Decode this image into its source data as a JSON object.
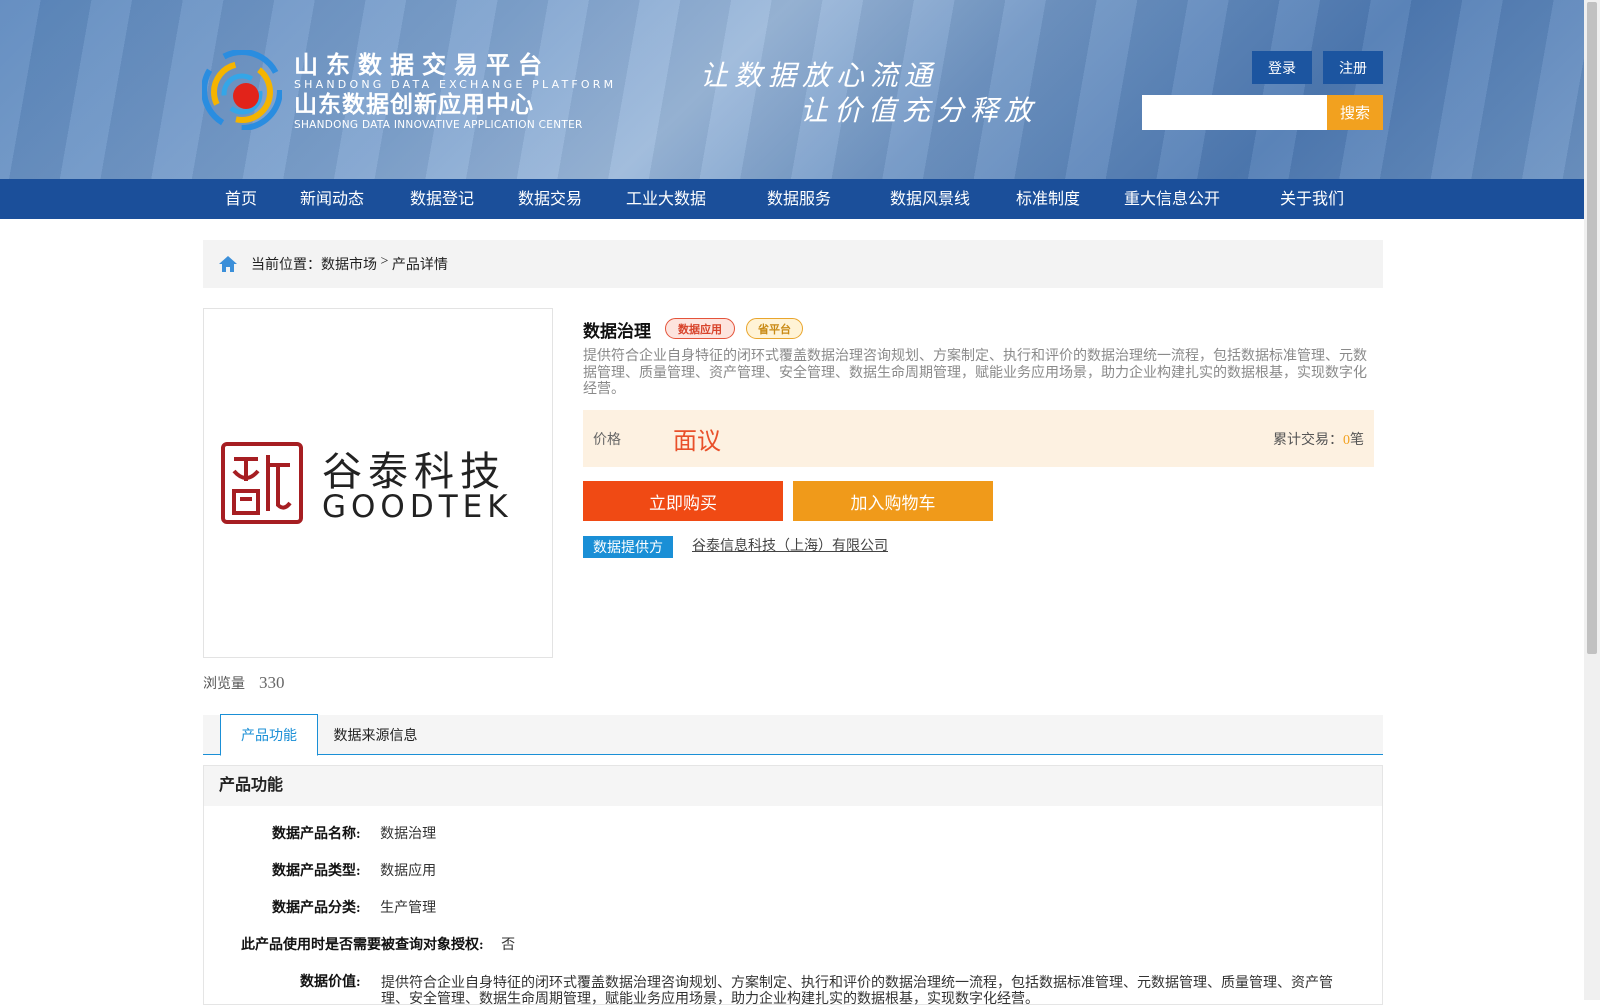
{
  "header": {
    "logo_cn_1": "山东数据交易平台",
    "logo_en_1": "SHANDONG DATA EXCHANGE PLATFORM",
    "logo_cn_2": "山东数据创新应用中心",
    "logo_en_2": "SHANDONG DATA INNOVATIVE APPLICATION CENTER",
    "slogan_1": "让数据放心流通",
    "slogan_2": "让价值充分释放",
    "login_label": "登录",
    "register_label": "注册",
    "search_placeholder": "",
    "search_label": "搜索"
  },
  "nav": {
    "items": [
      "首页",
      "新闻动态",
      "数据登记",
      "数据交易",
      "工业大数据",
      "数据服务",
      "数据风景线",
      "标准制度",
      "重大信息公开",
      "关于我们"
    ]
  },
  "breadcrumb": {
    "prefix": "当前位置：",
    "market": "数据市场",
    "separator": " > ",
    "current": "产品详情"
  },
  "product": {
    "logo_cn": "谷泰科技",
    "logo_en": "GOODTEK",
    "views_label": "浏览量",
    "views_count": "330",
    "title": "数据治理",
    "tag_app": "数据应用",
    "tag_prov": "省平台",
    "description": "提供符合企业自身特征的闭环式覆盖数据治理咨询规划、方案制定、执行和评价的数据治理统一流程，包括数据标准管理、元数据管理、质量管理、资产管理、安全管理、数据生命周期管理，赋能业务应用场景，助力企业构建扎实的数据根基，实现数字化经营。",
    "price_label": "价格",
    "price_value": "面议",
    "trade_label": "累计交易：",
    "trade_count": "0",
    "trade_unit": "笔",
    "buy_label": "立即购买",
    "cart_label": "加入购物车",
    "provider_label": "数据提供方",
    "provider_name": "谷泰信息科技（上海）有限公司"
  },
  "tabs": {
    "features": "产品功能",
    "source": "数据来源信息"
  },
  "features": {
    "heading": "产品功能",
    "name_label": "数据产品名称:",
    "name_value": "数据治理",
    "type_label": "数据产品类型:",
    "type_value": "数据应用",
    "category_label": "数据产品分类:",
    "category_value": "生产管理",
    "auth_label": "此产品使用时是否需要被查询对象授权:",
    "auth_value": "否",
    "value_label": "数据价值:",
    "value_text": "提供符合企业自身特征的闭环式覆盖数据治理咨询规划、方案制定、执行和评价的数据治理统一流程，包括数据标准管理、元数据管理、质量管理、资产管理、安全管理、数据生命周期管理，赋能业务应用场景，助力企业构建扎实的数据根基，实现数字化经营。"
  },
  "colors": {
    "nav_bg": "#1b4f9a",
    "accent_blue": "#1a8fd6",
    "buy_red": "#f04a14",
    "cart_orange": "#f09a1a",
    "price_red": "#e9502a"
  }
}
